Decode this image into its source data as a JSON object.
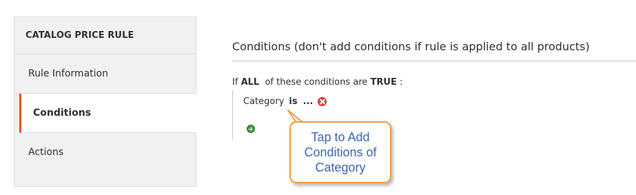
{
  "sidebar": {
    "title": "CATALOG PRICE RULE",
    "items": [
      {
        "label": "Rule Information"
      },
      {
        "label": "Conditions"
      },
      {
        "label": "Actions"
      }
    ]
  },
  "main": {
    "section_title": "Conditions (don't add conditions if rule is applied to all products)",
    "condition_line": {
      "prefix": "If",
      "aggregator": "ALL",
      "middle": "of these conditions are",
      "value": "TRUE",
      "suffix": ":"
    },
    "condition_row": {
      "attribute": "Category",
      "operator": "is",
      "value": "..."
    }
  },
  "callout": {
    "text": "Tap to Add Conditions of Category"
  },
  "colors": {
    "accent": "#eb5202",
    "callout_border": "#f29b3a",
    "callout_text": "#3a66b8",
    "remove": "#e24c4c",
    "add": "#3f9b3f"
  },
  "icons": {
    "remove": "remove-condition-icon",
    "add": "add-condition-icon"
  }
}
